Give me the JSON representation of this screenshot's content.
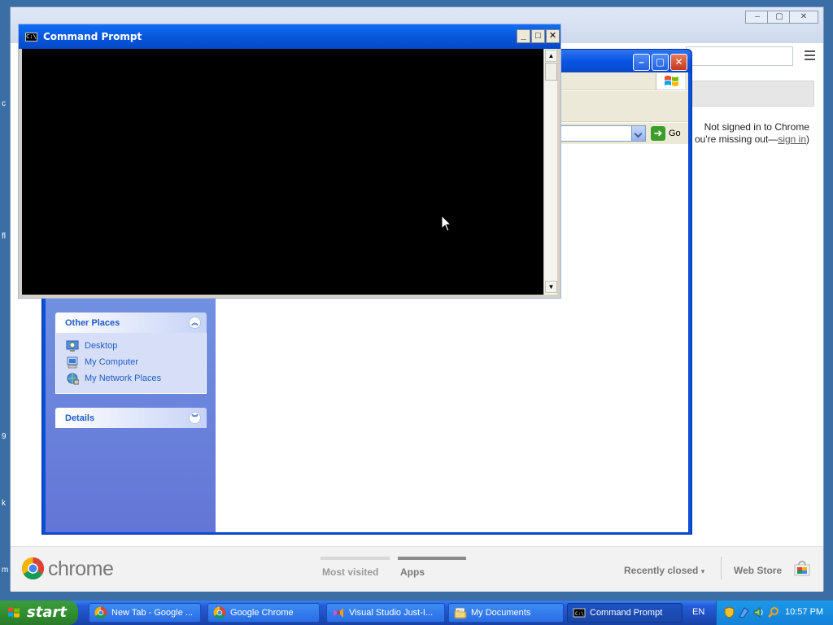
{
  "desktop": {
    "fragments": [
      "c",
      "fl",
      "9",
      "k",
      "m"
    ]
  },
  "chrome": {
    "window_controls": [
      "–",
      "▢",
      "✕"
    ],
    "signin": {
      "line1": "Not signed in to Chrome",
      "line2_prefix": "ou're missing out—",
      "link": "sign in",
      "line2_suffix": ")"
    },
    "bottombar": {
      "logo_text": "chrome",
      "tabs": [
        {
          "label": "Most visited",
          "active": false
        },
        {
          "label": "Apps",
          "active": true
        }
      ],
      "recently_closed": "Recently closed",
      "web_store": "Web Store"
    }
  },
  "explorer": {
    "title": "My Documents",
    "go_label": "Go",
    "other_places": {
      "title": "Other Places",
      "items": [
        {
          "label": "Desktop",
          "icon": "desktop-icon"
        },
        {
          "label": "My Computer",
          "icon": "computer-icon"
        },
        {
          "label": "My Network Places",
          "icon": "network-icon"
        }
      ]
    },
    "details": {
      "title": "Details"
    }
  },
  "cmd": {
    "title": "Command Prompt",
    "icon_text": "C:\\",
    "content": ""
  },
  "taskbar": {
    "start_label": "start",
    "buttons": [
      {
        "label": "New Tab - Google ...",
        "icon": "chrome-icon",
        "active": false
      },
      {
        "label": "Google Chrome",
        "icon": "chrome-icon",
        "active": false
      },
      {
        "label": "Visual Studio Just-I...",
        "icon": "visual-studio-icon",
        "active": false
      },
      {
        "label": "My Documents",
        "icon": "folder-icon",
        "active": false
      },
      {
        "label": "Command Prompt",
        "icon": "cmd-icon",
        "active": true
      }
    ],
    "language": "EN",
    "clock": "10:57 PM"
  },
  "colors": {
    "xp_blue": "#0a4fd6",
    "task_pane_link": "#215dc6",
    "start_green": "#2e8b2e",
    "console_bg": "#000000"
  }
}
